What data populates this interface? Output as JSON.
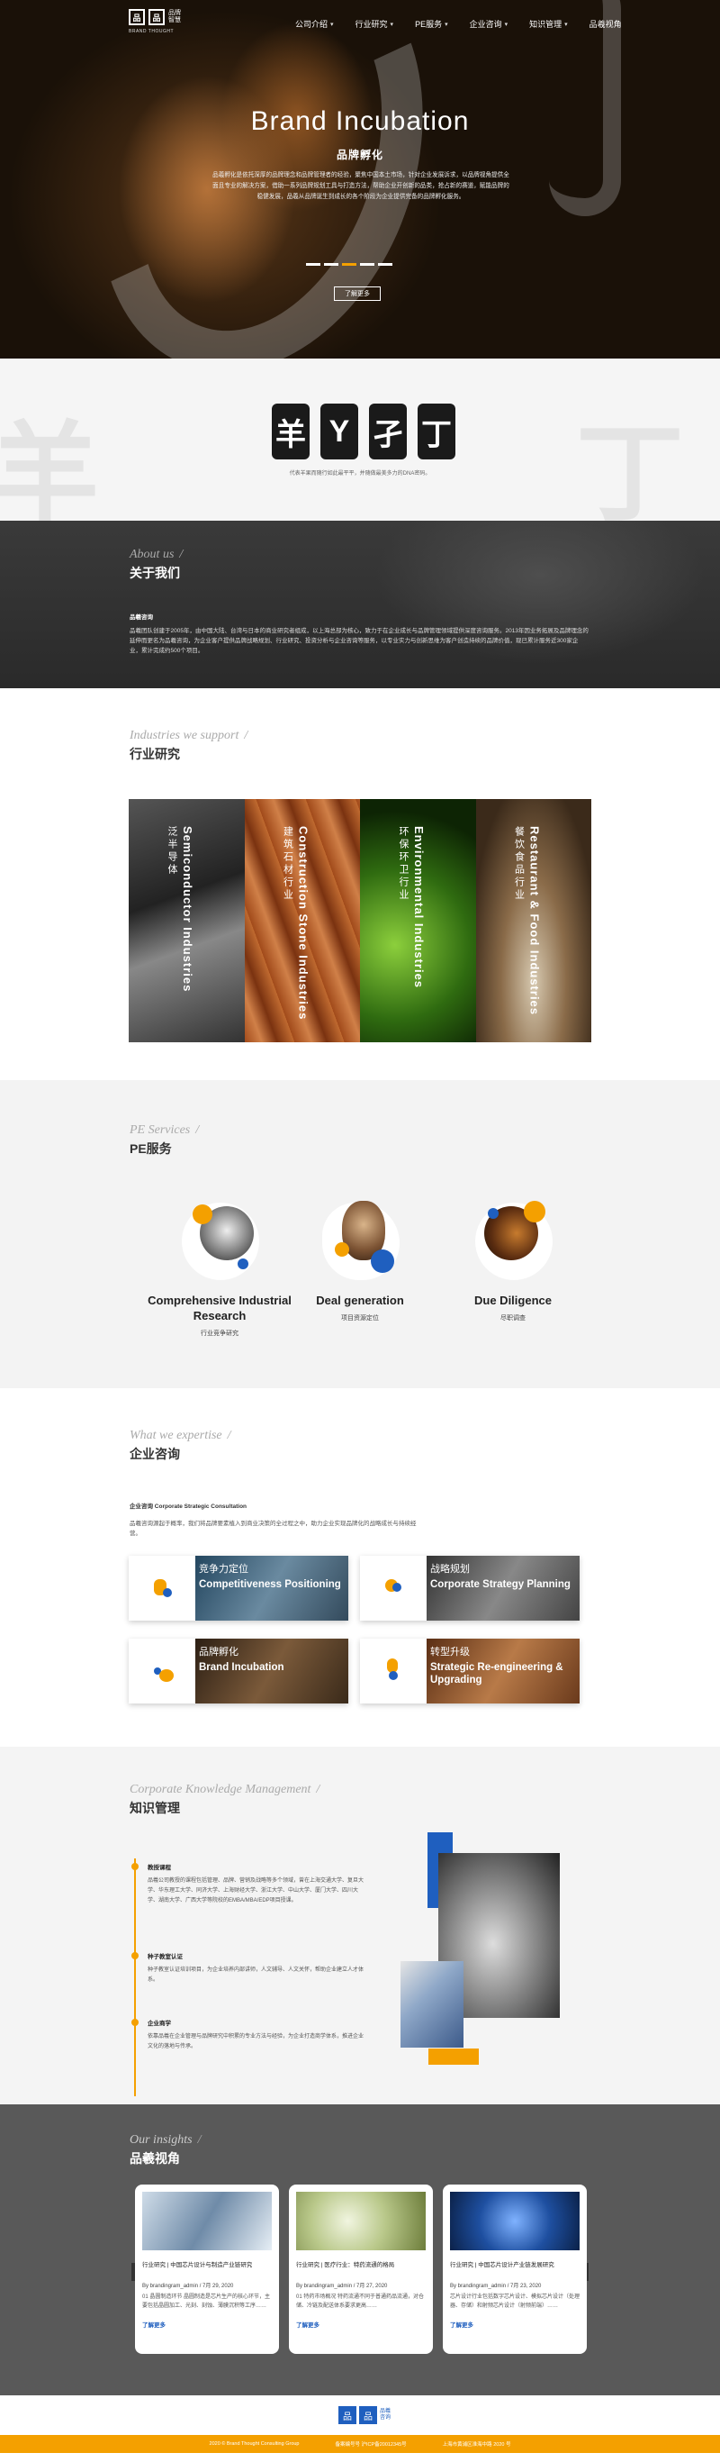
{
  "nav": {
    "logo_mark": "品",
    "logo_text_1": "品牌",
    "logo_text_2": "智慧",
    "logo_sub": "BRAND THOUGHT",
    "items": [
      {
        "label": "公司介绍",
        "has_dropdown": true
      },
      {
        "label": "行业研究",
        "has_dropdown": true
      },
      {
        "label": "PE服务",
        "has_dropdown": true
      },
      {
        "label": "企业咨询",
        "has_dropdown": true
      },
      {
        "label": "知识管理",
        "has_dropdown": true
      },
      {
        "label": "品羲视角",
        "has_dropdown": false
      }
    ]
  },
  "hero": {
    "title": "Brand Incubation",
    "subtitle": "品牌孵化",
    "description": "品羲孵化是依托深厚的品牌理念和品牌管理者的经验，聚焦中国本土市场，针对企业发展诉求，以品牌视角提供全面且专业的解决方案，借助一系列品牌规划工具与打造方法，帮助企业开创新的品类，抢占新的赛道，赋能品牌的稳健发展，品羲从品牌诞生到成长的各个阶段为企业提供完备的品牌孵化服务。",
    "slides": 5,
    "active_slide": 2,
    "button": "了解更多"
  },
  "brand": {
    "glyphs": [
      "羊",
      "Y",
      "孑",
      "丁"
    ],
    "caption": "代表羊果而随行如此最平平，并随做最美多力的DNA密码。"
  },
  "about": {
    "en": "About us",
    "cn": "关于我们",
    "sub": "品羲咨询",
    "text": "品羲团队创建于2005年，由中国大陆、台湾与日本的商业研究者组成，以上海总部为核心，致力于在企业成长与品牌管理领域提供深度咨询服务。2013年因业务拓展及品牌理念的延伸而更名为品羲咨询，为企业客户提供品牌战略规划、行业研究、投资分析与企业咨询等服务，以专业实力与创新思维为客户创造持续的品牌价值，现已累计服务近300家企业，累计完成约500个项目。"
  },
  "industry": {
    "en": "Industries we support",
    "cn": "行业研究",
    "panels": [
      {
        "en": "Semiconductor Industries",
        "cn": "泛半导体"
      },
      {
        "en": "Construction Stone Industries",
        "cn": "建筑石材行业"
      },
      {
        "en": "Environmental Industries",
        "cn": "环保环卫行业"
      },
      {
        "en": "Restaurant & Food Industries",
        "cn": "餐饮食品行业"
      }
    ]
  },
  "pe": {
    "en": "PE Services",
    "cn": "PE服务",
    "items": [
      {
        "en": "Comprehensive Industrial Research",
        "cn": "行业竞争研究"
      },
      {
        "en": "Deal generation",
        "cn": "项目资源定位"
      },
      {
        "en": "Due Diligence",
        "cn": "尽职调查"
      }
    ]
  },
  "consult": {
    "en": "What we expertise",
    "cn": "企业咨询",
    "sub": "企业咨询 Corporate Strategic Consultation",
    "text": "品羲咨询源起于概率，我们将品牌要素植入到商业决策的全过程之中，助力企业实现品牌化的战略成长与持续经营。",
    "cards": [
      {
        "cn": "竞争力定位",
        "en": "Competitiveness Positioning"
      },
      {
        "cn": "战略规划",
        "en": "Corporate Strategy Planning"
      },
      {
        "cn": "品牌孵化",
        "en": "Brand Incubation"
      },
      {
        "cn": "转型升级",
        "en": "Strategic Re-engineering & Upgrading"
      }
    ]
  },
  "knowledge": {
    "en": "Corporate Knowledge Management",
    "cn": "知识管理",
    "items": [
      {
        "title": "教授课程",
        "desc": "品羲公司教授的课程包括管理、品牌、营销及战略等多个领域，曾在上海交通大学、复旦大学、华东理工大学、同济大学、上海财经大学、浙江大学、中山大学、厦门大学、四川大学、湖南大学、广西大学等院校的EMBA/MBA/EDP项目授课。"
      },
      {
        "title": "种子教室认证",
        "desc": "种子教室认证培训项目，为企业培养内部讲师，人文辅导、人文关怀，帮助企业建立人才体系。"
      },
      {
        "title": "企业商学",
        "desc": "依靠品羲在企业管理与品牌研究中积累的专业方法与经验，为企业打造商学体系，推进企业文化的落地与传承。"
      }
    ]
  },
  "insights": {
    "en": "Our insights",
    "cn": "品羲视角",
    "cards": [
      {
        "title": "行业研究 | 中国芯片设计与制造产业链研究",
        "meta": "By brandingram_admin / 7月 29, 2020",
        "excerpt": "01 晶圆制造环节 晶圆制造是芯片生产的核心环节，主要包括晶圆加工、光刻、刻蚀、薄膜沉积等工序……",
        "more": "了解更多"
      },
      {
        "title": "行业研究 | 医疗行业：特药流通的格局",
        "meta": "By brandingram_admin / 7月 27, 2020",
        "excerpt": "01 特药市场概况 特药流通不同于普通药品流通，对仓储、冷链及配送体系要求更高……",
        "more": "了解更多"
      },
      {
        "title": "行业研究 | 中国芯片设计产业链发展研究",
        "meta": "By brandingram_admin / 7月 23, 2020",
        "excerpt": "芯片设计行业包括数字芯片设计、模拟芯片设计（处理器、存储）和射频芯片设计（射频前端）……",
        "more": "了解更多"
      }
    ]
  },
  "footer": {
    "logo_mark": "品",
    "logo_text_1": "品羲",
    "logo_text_2": "咨询",
    "copyright": "2020 © Brand Thought Consulting Group",
    "icp": "备案编号号 沪ICP备20012345号",
    "address": "上海市黄浦区淮海中路 2020 号"
  },
  "colors": {
    "accent": "#f4a000",
    "brand_blue": "#1f5fbf",
    "dark": "#2f2f2f",
    "insights_bg": "#595959"
  }
}
